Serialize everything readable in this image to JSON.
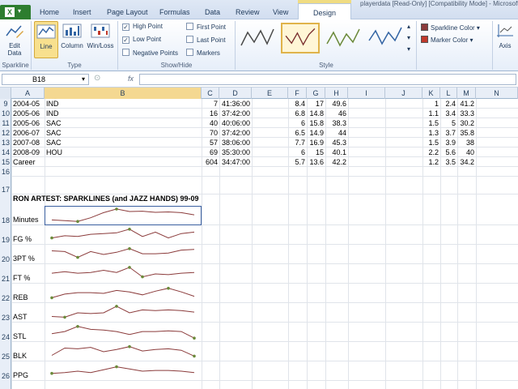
{
  "tabs": [
    "Home",
    "Insert",
    "Page Layout",
    "Formulas",
    "Data",
    "Review",
    "View",
    "Design"
  ],
  "title_fragment": "playerdata [Read-Only] [Compatibility Mode] - Microsoft Excel",
  "ribbon": {
    "edit_data": "Edit Data",
    "sparkline_group": "Sparkline",
    "type_group": "Type",
    "type_buttons": [
      "Line",
      "Column",
      "Win/Loss"
    ],
    "show_hide_group": "Show/Hide",
    "checks": [
      {
        "label": "High Point",
        "checked": true
      },
      {
        "label": "Low Point",
        "checked": true
      },
      {
        "label": "Negative Points",
        "checked": false
      },
      {
        "label": "First Point",
        "checked": false
      },
      {
        "label": "Last Point",
        "checked": false
      },
      {
        "label": "Markers",
        "checked": false
      }
    ],
    "style_group": "Style",
    "sparkline_color": "Sparkline Color",
    "marker_color": "Marker Color",
    "axis": "Axis"
  },
  "namebox": "B18",
  "fx": "fx",
  "columns": [
    "A",
    "B",
    "C",
    "D",
    "E",
    "F",
    "G",
    "H",
    "I",
    "J",
    "K",
    "L",
    "M",
    "N"
  ],
  "rows": [
    {
      "n": "9",
      "a": "2004-05",
      "b": "IND",
      "c": "7",
      "d": "41:36:00",
      "f": "8.4",
      "g": "17",
      "h": "49.6",
      "k": "1",
      "l": "2.4",
      "m": "41.2"
    },
    {
      "n": "10",
      "a": "2005-06",
      "b": "IND",
      "c": "16",
      "d": "37:42:00",
      "f": "6.8",
      "g": "14.8",
      "h": "46",
      "k": "1.1",
      "l": "3.4",
      "m": "33.3"
    },
    {
      "n": "11",
      "a": "2005-06",
      "b": "SAC",
      "c": "40",
      "d": "40:06:00",
      "f": "6",
      "g": "15.8",
      "h": "38.3",
      "k": "1.5",
      "l": "5",
      "m": "30.2"
    },
    {
      "n": "12",
      "a": "2006-07",
      "b": "SAC",
      "c": "70",
      "d": "37:42:00",
      "f": "6.5",
      "g": "14.9",
      "h": "44",
      "k": "1.3",
      "l": "3.7",
      "m": "35.8"
    },
    {
      "n": "13",
      "a": "2007-08",
      "b": "SAC",
      "c": "57",
      "d": "38:06:00",
      "f": "7.7",
      "g": "16.9",
      "h": "45.3",
      "k": "1.5",
      "l": "3.9",
      "m": "38"
    },
    {
      "n": "14",
      "a": "2008-09",
      "b": "HOU",
      "c": "69",
      "d": "35:30:00",
      "f": "6",
      "g": "15",
      "h": "40.1",
      "k": "2.2",
      "l": "5.6",
      "m": "40"
    },
    {
      "n": "15",
      "a": "Career",
      "b": "",
      "c": "604",
      "d": "34:47:00",
      "f": "5.7",
      "g": "13.6",
      "h": "42.2",
      "k": "1.2",
      "l": "3.5",
      "m": "34.2"
    }
  ],
  "sheet_title": "RON ARTEST: SPARKLINES (and JAZZ HANDS) 99-09",
  "spark_rows": [
    {
      "n": "18",
      "label": "Minutes",
      "values": [
        0.2,
        0.15,
        0.1,
        0.35,
        0.7,
        0.95,
        0.78,
        0.8,
        0.72,
        0.75,
        0.7,
        0.55
      ]
    },
    {
      "n": "19",
      "label": "FG %",
      "values": [
        0.3,
        0.45,
        0.4,
        0.55,
        0.6,
        0.65,
        0.9,
        0.4,
        0.7,
        0.3,
        0.6,
        0.7
      ]
    },
    {
      "n": "20",
      "label": "3PT %",
      "values": [
        0.75,
        0.7,
        0.3,
        0.7,
        0.5,
        0.65,
        0.9,
        0.55,
        0.55,
        0.6,
        0.8,
        0.85
      ]
    },
    {
      "n": "21",
      "label": "FT %",
      "values": [
        0.55,
        0.65,
        0.55,
        0.6,
        0.75,
        0.6,
        0.95,
        0.3,
        0.5,
        0.45,
        0.55,
        0.6
      ]
    },
    {
      "n": "22",
      "label": "REB",
      "values": [
        0.2,
        0.45,
        0.55,
        0.55,
        0.5,
        0.7,
        0.6,
        0.4,
        0.65,
        0.85,
        0.6,
        0.3
      ]
    },
    {
      "n": "23",
      "label": "AST",
      "values": [
        0.25,
        0.2,
        0.5,
        0.45,
        0.5,
        0.95,
        0.5,
        0.7,
        0.65,
        0.7,
        0.65,
        0.55
      ]
    },
    {
      "n": "24",
      "label": "STL",
      "values": [
        0.4,
        0.55,
        0.9,
        0.7,
        0.65,
        0.55,
        0.35,
        0.55,
        0.55,
        0.6,
        0.55,
        0.1
      ]
    },
    {
      "n": "25",
      "label": "BLK",
      "values": [
        0.25,
        0.75,
        0.7,
        0.8,
        0.5,
        0.65,
        0.85,
        0.55,
        0.65,
        0.7,
        0.6,
        0.2
      ]
    },
    {
      "n": "26",
      "label": "PPG",
      "values": [
        0.35,
        0.4,
        0.5,
        0.4,
        0.6,
        0.8,
        0.65,
        0.5,
        0.55,
        0.55,
        0.5,
        0.4
      ]
    }
  ],
  "colors": {
    "spark_line": "#8b3b3b",
    "marker": "#6b8a3a",
    "accent": "#2d7d2f"
  }
}
